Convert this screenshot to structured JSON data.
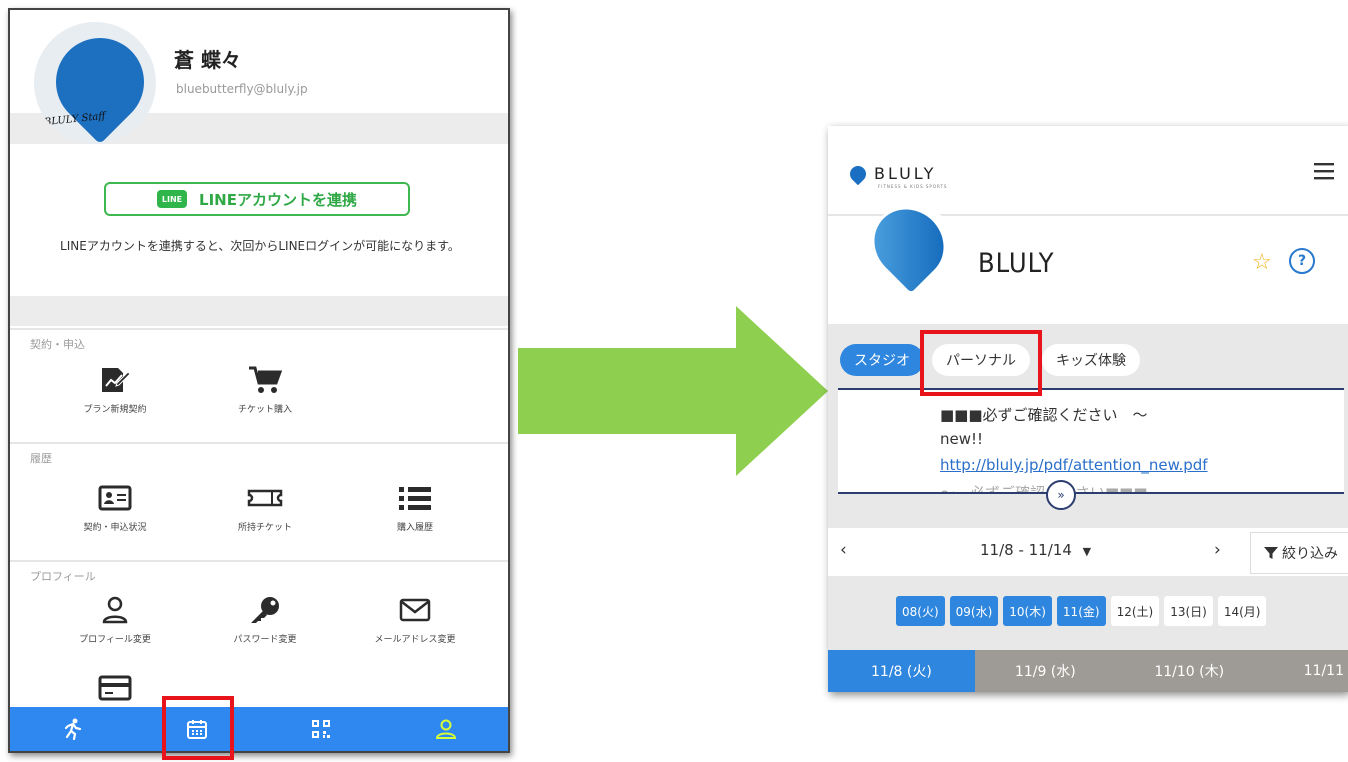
{
  "left_app": {
    "user": {
      "name": "蒼 蝶々",
      "email": "bluebutterfly@bluly.jp",
      "avatar_text": "BLULY Staff"
    },
    "line_link": {
      "button_label": "LINEアカウントを連携",
      "logo_text": "LINE",
      "description": "LINEアカウントを連携すると、次回からLINEログインが可能になります。"
    },
    "sections": {
      "contract": {
        "label": "契約・申込",
        "items": [
          "プラン新規契約",
          "チケット購入"
        ]
      },
      "history": {
        "label": "履歴",
        "items": [
          "契約・申込状況",
          "所持チケット",
          "購入履歴"
        ]
      },
      "profile": {
        "label": "プロフィール",
        "items": [
          "プロフィール変更",
          "パスワード変更",
          "メールアドレス変更"
        ]
      }
    },
    "bottom_nav": {
      "items": [
        "running-icon",
        "calendar-icon",
        "qr-code-icon",
        "user-icon"
      ],
      "bg_color": "#2f87f0"
    }
  },
  "right_app": {
    "header": {
      "logo_text": "BLULY",
      "logo_subtext": "FITNESS & KIDS SPORTS"
    },
    "studio": {
      "name": "BLULY"
    },
    "tabs": [
      "スタジオ",
      "パーソナル",
      "キッズ体験"
    ],
    "active_tab": "スタジオ",
    "notice": {
      "line1": "■■■必ずご確認ください　～",
      "line2": "new!!",
      "link": "http://bluly.jp/pdf/attention_new.pdf",
      "line4": "～　必ずご確認ください■■■"
    },
    "week": {
      "range": "11/8 - 11/14",
      "filter_label": "絞り込み"
    },
    "dates": [
      {
        "label": "08(火)",
        "selected": true
      },
      {
        "label": "09(水)",
        "selected": true
      },
      {
        "label": "10(木)",
        "selected": true
      },
      {
        "label": "11(金)",
        "selected": true
      },
      {
        "label": "12(土)",
        "selected": false
      },
      {
        "label": "13(日)",
        "selected": false
      },
      {
        "label": "14(月)",
        "selected": false
      }
    ],
    "day_tabs": [
      "11/8 (火)",
      "11/9 (水)",
      "11/10 (木)",
      "11/11"
    ]
  },
  "colors": {
    "accent_blue": "#2e86de",
    "line_green": "#3fb84f",
    "highlight_red": "#e8141b",
    "arrow_green": "#8fcf4f"
  }
}
